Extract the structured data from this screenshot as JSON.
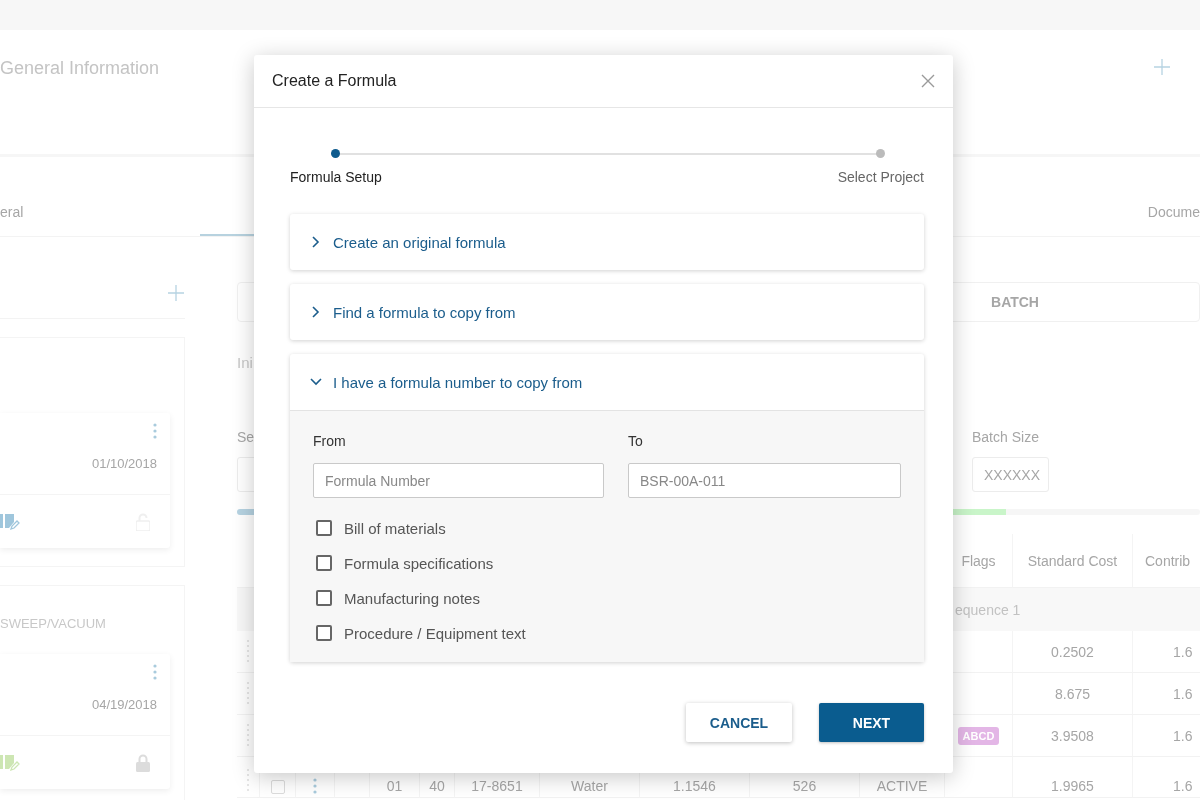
{
  "background": {
    "header": {
      "title": "General Information"
    },
    "tabs": [
      "eral",
      "Docume"
    ],
    "cards": [
      {
        "date": "01/10/2018",
        "color": "#9fc6dc",
        "locked": false
      },
      {
        "title": "SWEEP/VACUUM",
        "date": "04/19/2018",
        "color": "#cde6b3",
        "locked": true
      }
    ],
    "main": {
      "tab": "BATCH",
      "section_label": "Ini",
      "field_label": "Se",
      "batch_size": {
        "label": "Batch Size",
        "placeholder": "XXXXXX"
      },
      "table": {
        "columns": [
          "Flags",
          "Standard Cost",
          "Contrib"
        ],
        "group": "equence 1",
        "rows": [
          {
            "standard_cost": "0.2502",
            "contribution": "1.6"
          },
          {
            "standard_cost": "8.675",
            "contribution": "1.6"
          },
          {
            "flag": "ABCD",
            "standard_cost": "3.9508",
            "contribution": "1.6"
          },
          {
            "checked": false,
            "cells": [
              "01",
              "40",
              "17-8651",
              "Water",
              "1.1546",
              "526",
              "ACTIVE"
            ],
            "standard_cost": "1.9965",
            "contribution": "1.6"
          }
        ]
      }
    }
  },
  "dialog": {
    "title": "Create a Formula",
    "steps": [
      {
        "label": "Formula Setup",
        "selected": true
      },
      {
        "label": "Select Project",
        "selected": false
      }
    ],
    "options": [
      {
        "label": "Create an original formula",
        "expanded": false
      },
      {
        "label": "Find a formula to copy from",
        "expanded": false
      },
      {
        "label": "I have a formula number to copy from",
        "expanded": true,
        "fields": [
          {
            "label": "From",
            "placeholder": "Formula Number"
          },
          {
            "label": "To",
            "placeholder": "BSR-00A-011"
          }
        ],
        "copy_items": [
          {
            "label": "Bill of materials",
            "checked": false
          },
          {
            "label": "Formula specifications",
            "checked": false
          },
          {
            "label": "Manufacturing notes",
            "checked": false
          },
          {
            "label": "Procedure / Equipment text",
            "checked": false
          }
        ]
      }
    ],
    "buttons": [
      {
        "label": "CANCEL",
        "kind": "secondary"
      },
      {
        "label": "NEXT",
        "kind": "primary"
      }
    ]
  }
}
